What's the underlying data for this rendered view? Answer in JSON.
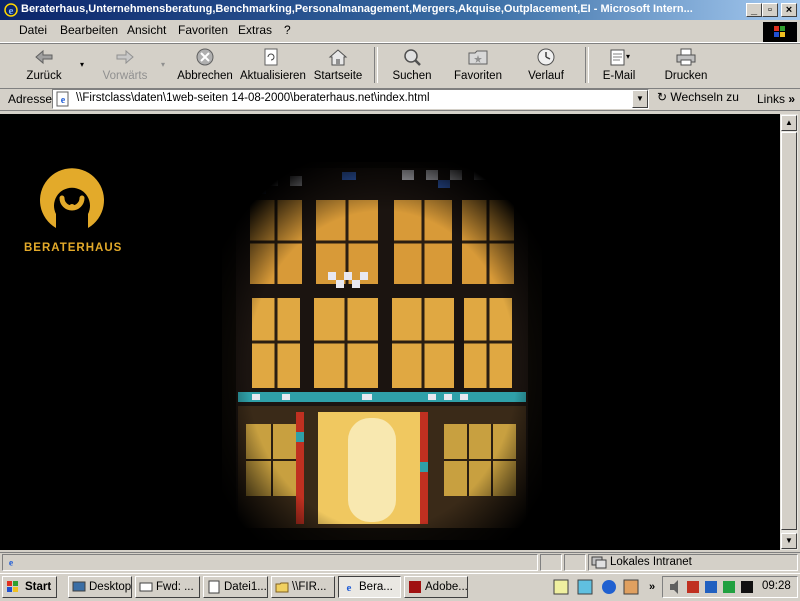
{
  "window": {
    "title": "Beraterhaus,Unternehmensberatung,Benchmarking,Personalmanagement,Mergers,Akquise,Outplacement,EI - Microsoft Intern..."
  },
  "menu": [
    {
      "label": "Datei"
    },
    {
      "label": "Bearbeiten"
    },
    {
      "label": "Ansicht"
    },
    {
      "label": "Favoriten"
    },
    {
      "label": "Extras"
    },
    {
      "label": "?"
    }
  ],
  "toolbar": {
    "back": "Zurück",
    "forward": "Vorwärts",
    "stop": "Abbrechen",
    "refresh": "Aktualisieren",
    "home": "Startseite",
    "search": "Suchen",
    "favorites": "Favoriten",
    "history": "Verlauf",
    "mail": "E-Mail",
    "print": "Drucken"
  },
  "address": {
    "label": "Adresse",
    "url": "\\\\Firstclass\\daten\\1web-seiten 14-08-2000\\beraterhaus.net\\index.html",
    "go": "Wechseln zu",
    "links": "Links"
  },
  "page": {
    "logo_text": "BERATERHAUS"
  },
  "status": {
    "zone": "Lokales Intranet"
  },
  "taskbar": {
    "start": "Start",
    "tasks": [
      {
        "label": "Desktop"
      },
      {
        "label": "Fwd: ..."
      },
      {
        "label": "Datei1..."
      },
      {
        "label": "\\\\FIR..."
      },
      {
        "label": "Bera..."
      },
      {
        "label": "Adobe..."
      }
    ],
    "clock": "09:28"
  },
  "colors": {
    "title_bar": "#0a246a",
    "logo": "#e3aa2a",
    "content_bg": "#000000"
  }
}
